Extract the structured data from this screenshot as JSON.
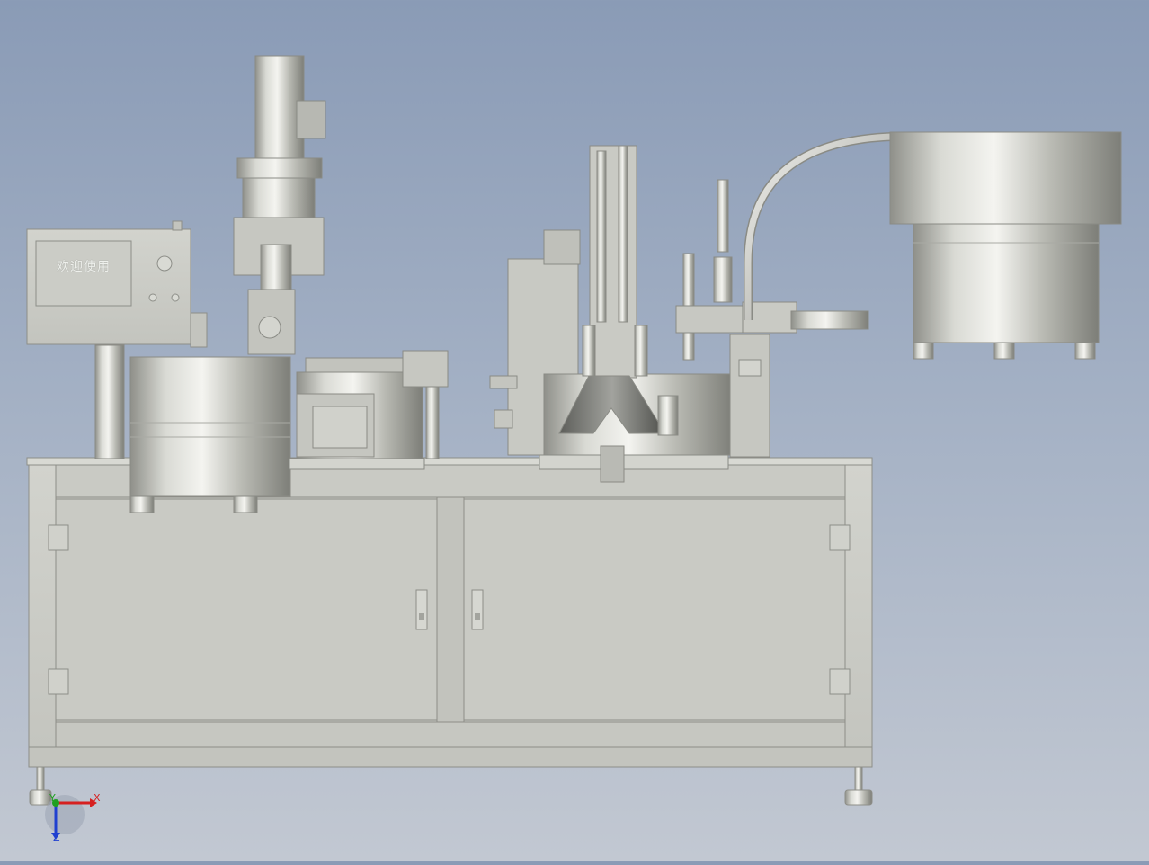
{
  "viewer": {
    "triad": {
      "x": "X",
      "y": "Y",
      "z": "Z"
    }
  },
  "machine": {
    "control_panel_text": "欢迎使用"
  },
  "colors": {
    "background_top": "#8a9bb6",
    "background_bottom": "#c2c8d2",
    "metal": "#c8c9c2",
    "metal_dark": "#8a8b85",
    "axis_x": "#d62020",
    "axis_y": "#20a020",
    "axis_z": "#2040d0"
  }
}
